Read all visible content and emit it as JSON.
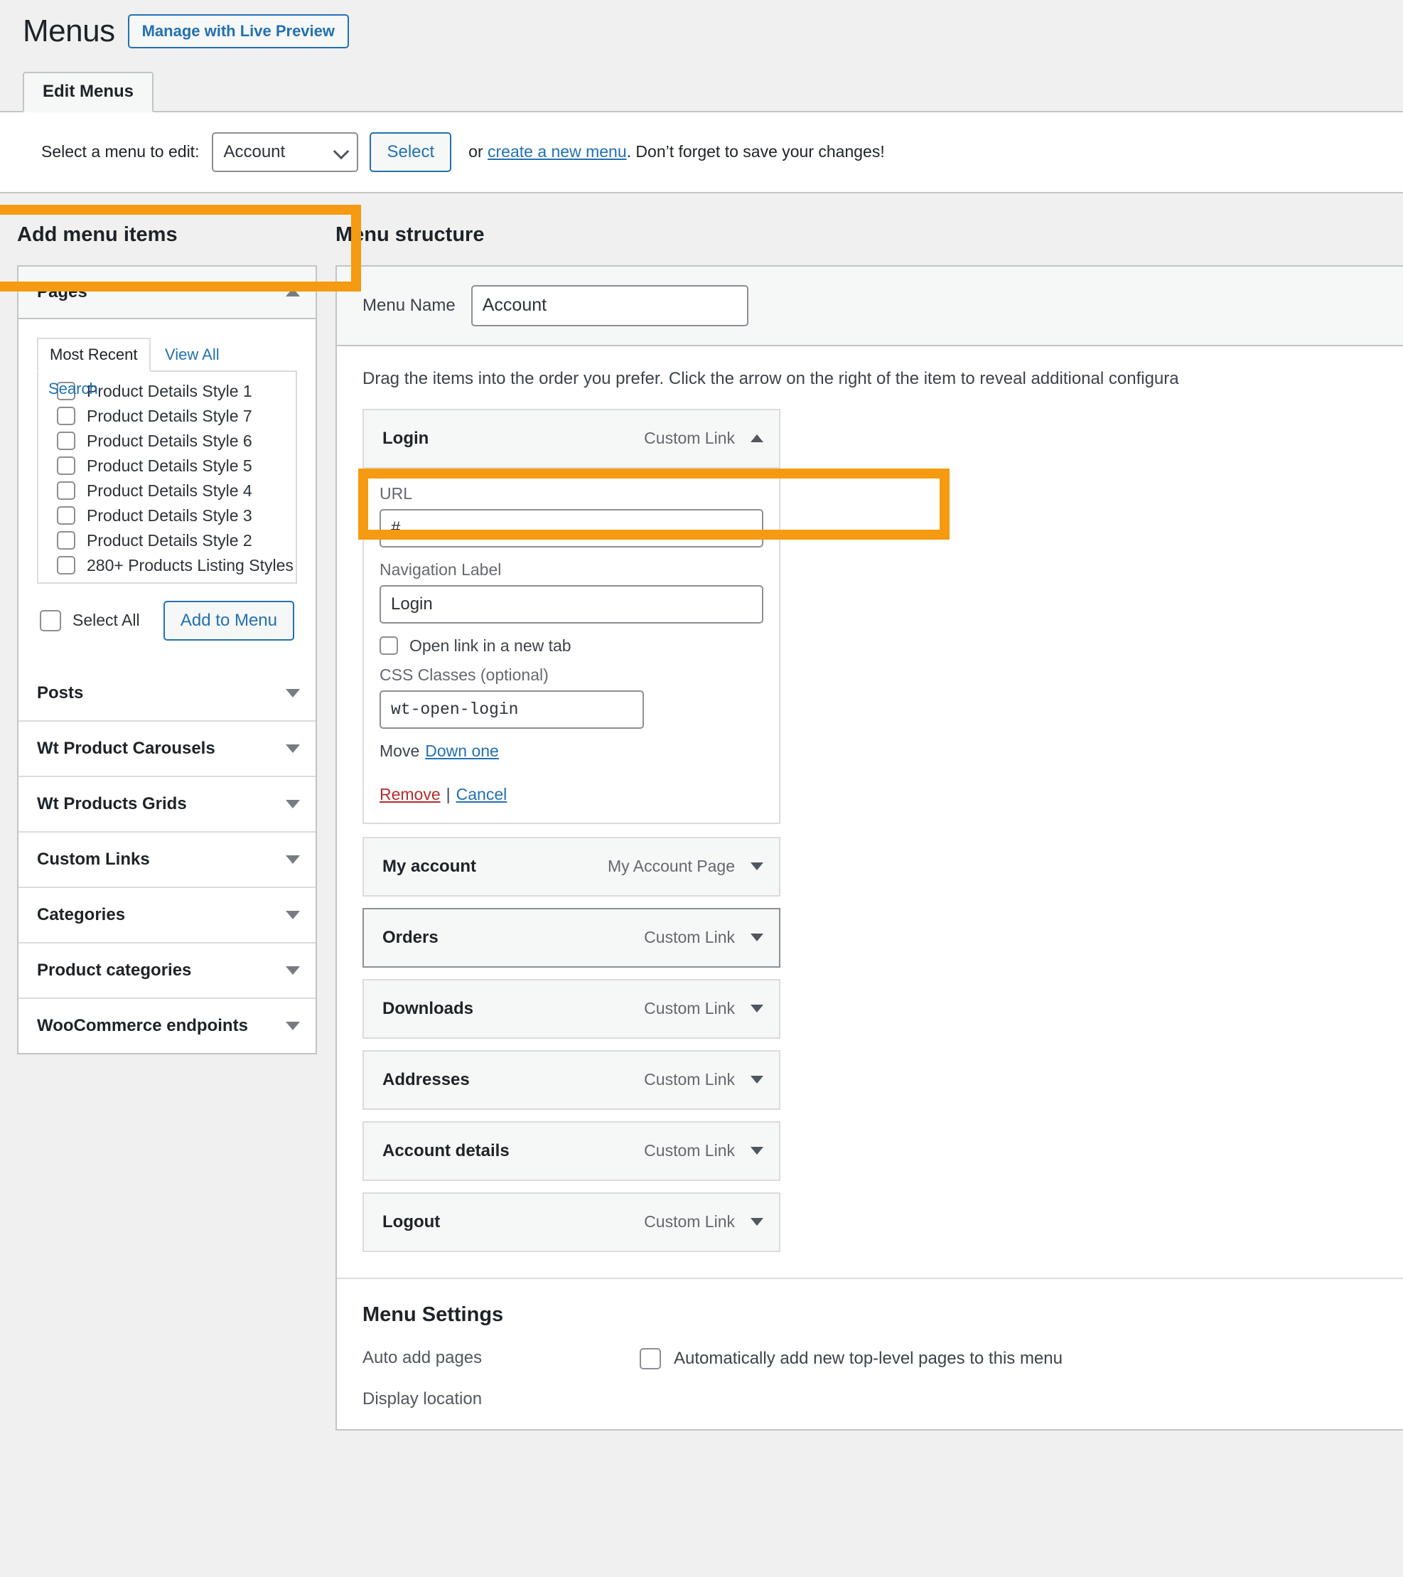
{
  "header": {
    "title": "Menus",
    "live_preview_label": "Manage with Live Preview"
  },
  "tabs": [
    {
      "label": "Edit Menus",
      "active": true
    }
  ],
  "select_bar": {
    "label": "Select a menu to edit:",
    "selected_menu": "Account",
    "options": [
      "Account"
    ],
    "select_button": "Select",
    "note_prefix": "or ",
    "note_link": "create a new menu",
    "note_suffix": ". Don’t forget to save your changes!"
  },
  "add_menu_items": {
    "title": "Add menu items",
    "pages_panel": {
      "title": "Pages",
      "expanded": true,
      "tabs": [
        {
          "label": "Most Recent",
          "active": true
        },
        {
          "label": "View All",
          "active": false
        },
        {
          "label": "Search",
          "active": false
        }
      ],
      "items": [
        {
          "label": "Product Details Style 1",
          "checked": false
        },
        {
          "label": "Product Details Style 7",
          "checked": false
        },
        {
          "label": "Product Details Style 6",
          "checked": false
        },
        {
          "label": "Product Details Style 5",
          "checked": false
        },
        {
          "label": "Product Details Style 4",
          "checked": false
        },
        {
          "label": "Product Details Style 3",
          "checked": false
        },
        {
          "label": "Product Details Style 2",
          "checked": false
        },
        {
          "label": "280+ Products Listing Styles",
          "checked": false
        }
      ],
      "select_all_label": "Select All",
      "add_to_menu_label": "Add to Menu"
    },
    "collapsed_panels": [
      {
        "label": "Posts"
      },
      {
        "label": "Wt Product Carousels"
      },
      {
        "label": "Wt Products Grids"
      },
      {
        "label": "Custom Links"
      },
      {
        "label": "Categories"
      },
      {
        "label": "Product categories"
      },
      {
        "label": "WooCommerce endpoints"
      }
    ]
  },
  "menu_structure": {
    "title": "Menu structure",
    "menu_name_label": "Menu Name",
    "menu_name_value": "Account",
    "drag_hint": "Drag the items into the order you prefer. Click the arrow on the right of the item to reveal additional configura",
    "expanded_item": {
      "title": "Login",
      "type": "Custom Link",
      "url_label": "URL",
      "url_value": "#",
      "nav_label_label": "Navigation Label",
      "nav_label_value": "Login",
      "new_tab_label": "Open link in a new tab",
      "new_tab_checked": false,
      "css_label": "CSS Classes (optional)",
      "css_value": "wt-open-login",
      "move_label": "Move",
      "move_link": "Down one",
      "remove_label": "Remove",
      "separator": "|",
      "cancel_label": "Cancel"
    },
    "items": [
      {
        "title": "My account",
        "type": "My Account Page",
        "hovered": false
      },
      {
        "title": "Orders",
        "type": "Custom Link",
        "hovered": true
      },
      {
        "title": "Downloads",
        "type": "Custom Link",
        "hovered": false
      },
      {
        "title": "Addresses",
        "type": "Custom Link",
        "hovered": false
      },
      {
        "title": "Account details",
        "type": "Custom Link",
        "hovered": false
      },
      {
        "title": "Logout",
        "type": "Custom Link",
        "hovered": false
      }
    ]
  },
  "menu_settings": {
    "title": "Menu Settings",
    "auto_add_label": "Auto add pages",
    "auto_add_checkbox_label": "Automatically add new top-level pages to this menu",
    "auto_add_checked": false,
    "display_location_label": "Display location"
  },
  "colors": {
    "highlight": "#f59a11",
    "link": "#2271b1",
    "danger": "#b32d2e",
    "page_bg": "#f0f0f1",
    "panel_bg": "#ffffff"
  }
}
